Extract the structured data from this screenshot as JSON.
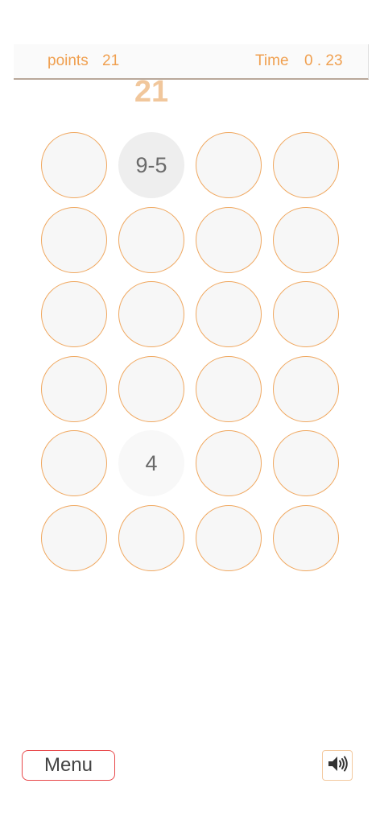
{
  "header": {
    "points_label": "points",
    "points_value": "21",
    "time_label": "Time",
    "time_value": "0 . 23"
  },
  "big_score": "21",
  "grid": {
    "cells": [
      {
        "text": "",
        "state": "empty"
      },
      {
        "text": "9-5",
        "state": "active"
      },
      {
        "text": "",
        "state": "empty"
      },
      {
        "text": "",
        "state": "empty"
      },
      {
        "text": "",
        "state": "empty"
      },
      {
        "text": "",
        "state": "empty"
      },
      {
        "text": "",
        "state": "empty"
      },
      {
        "text": "",
        "state": "empty"
      },
      {
        "text": "",
        "state": "empty"
      },
      {
        "text": "",
        "state": "empty"
      },
      {
        "text": "",
        "state": "empty"
      },
      {
        "text": "",
        "state": "empty"
      },
      {
        "text": "",
        "state": "empty"
      },
      {
        "text": "",
        "state": "empty"
      },
      {
        "text": "",
        "state": "empty"
      },
      {
        "text": "",
        "state": "empty"
      },
      {
        "text": "",
        "state": "empty"
      },
      {
        "text": "4",
        "state": "number"
      },
      {
        "text": "",
        "state": "empty"
      },
      {
        "text": "",
        "state": "empty"
      },
      {
        "text": "",
        "state": "empty"
      },
      {
        "text": "",
        "state": "empty"
      },
      {
        "text": "",
        "state": "empty"
      },
      {
        "text": "",
        "state": "empty"
      }
    ]
  },
  "footer": {
    "menu_label": "Menu",
    "sound_icon": "speaker-volume-icon"
  },
  "colors": {
    "accent": "#f0a050",
    "score": "#f1c79c",
    "menu_border": "#e8484a"
  }
}
